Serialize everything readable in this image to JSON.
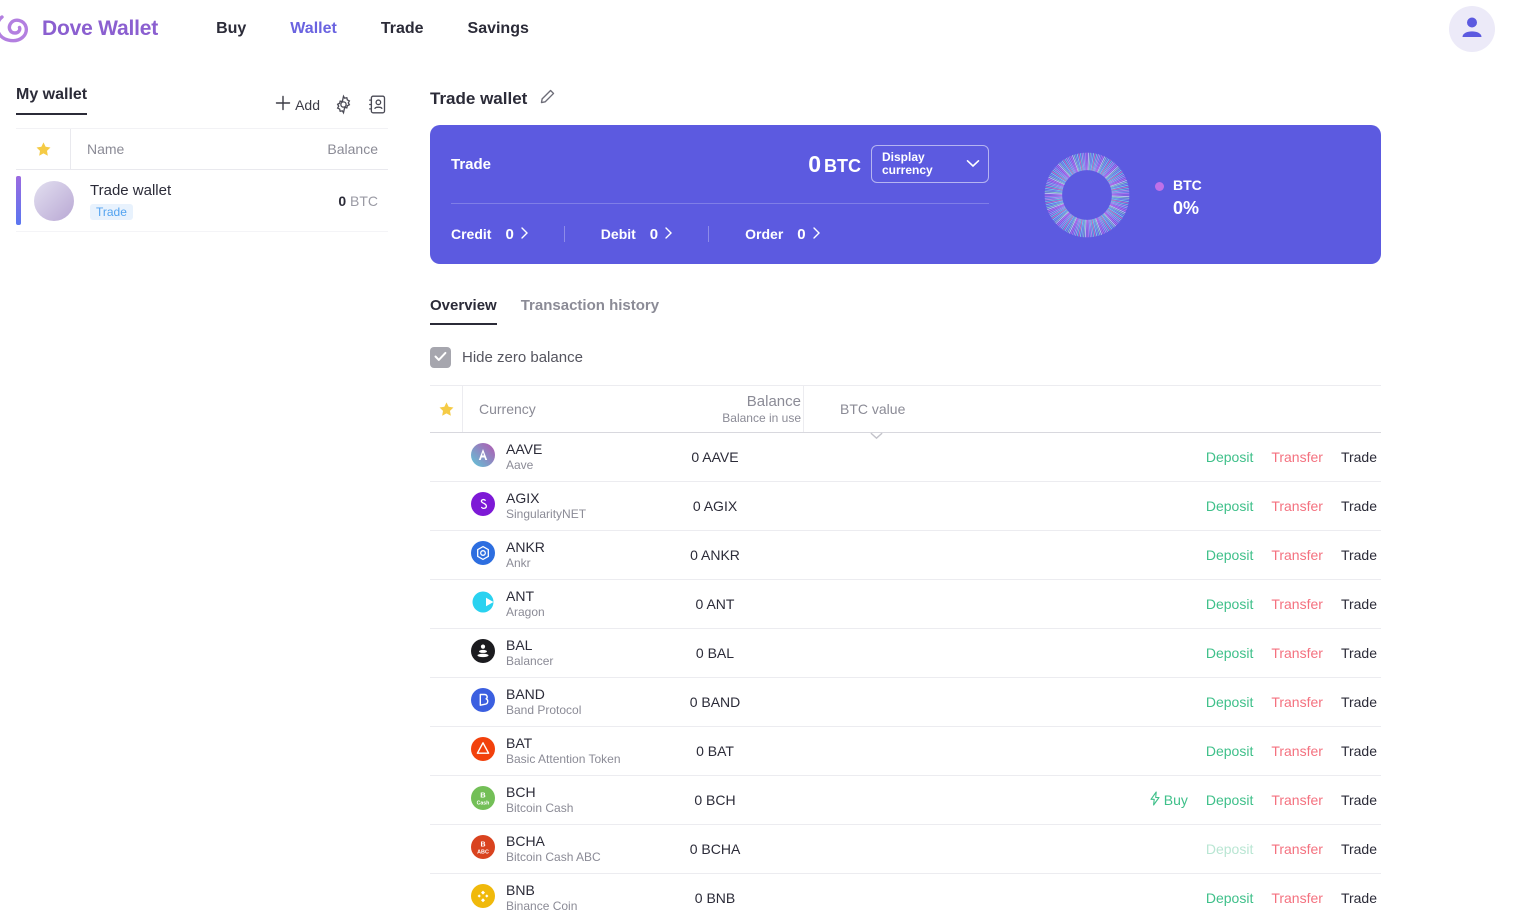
{
  "header": {
    "brand": "Dove Wallet",
    "logo_icon": "dove-spiral-logo",
    "nav": [
      {
        "label": "Buy",
        "active": false
      },
      {
        "label": "Wallet",
        "active": true
      },
      {
        "label": "Trade",
        "active": false
      },
      {
        "label": "Savings",
        "active": false
      }
    ],
    "avatar_icon": "user-avatar-icon"
  },
  "sidebar": {
    "title": "My wallet",
    "add_label": "Add",
    "add_icon": "plus-icon",
    "settings_icon": "gear-icon",
    "address_book_icon": "address-book-icon",
    "columns": {
      "star": "star-icon",
      "name": "Name",
      "balance": "Balance"
    },
    "wallets": [
      {
        "name": "Trade wallet",
        "tag": "Trade",
        "balance_value": "0",
        "balance_unit": "BTC",
        "selected": true
      }
    ]
  },
  "main": {
    "title": "Trade wallet",
    "edit_icon": "pencil-icon",
    "card": {
      "label": "Trade",
      "amount": "0",
      "unit": "BTC",
      "display_currency_label": "Display currency",
      "chevron_icon": "chevron-down-icon",
      "stats": [
        {
          "label": "Credit",
          "value": "0",
          "chevron": "chevron-right-icon"
        },
        {
          "label": "Debit",
          "value": "0",
          "chevron": "chevron-right-icon"
        },
        {
          "label": "Order",
          "value": "0",
          "chevron": "chevron-right-icon"
        }
      ],
      "legend": {
        "symbol": "BTC",
        "percent": "0%",
        "dot_color": "#c070e8"
      },
      "bg_color": "#5c5ae0"
    },
    "tabs": [
      {
        "label": "Overview",
        "active": true
      },
      {
        "label": "Transaction history",
        "active": false
      }
    ],
    "hide_zero": {
      "label": "Hide zero balance",
      "checked": true,
      "check_icon": "checkmark-icon"
    },
    "table": {
      "columns": {
        "star": "star-icon",
        "currency": "Currency",
        "balance": "Balance",
        "balance_in_use": "Balance in use",
        "btc_value": "BTC value",
        "sort_icon": "chevron-down-icon"
      },
      "rows": [
        {
          "symbol": "AAVE",
          "name": "Aave",
          "balance": "0 AAVE",
          "btc_value": "",
          "icon": {
            "kind": "aave",
            "bg": "#8e6fc4",
            "fg": "#ffffff"
          },
          "actions": [
            {
              "label": "Deposit",
              "type": "deposit",
              "disabled": false
            },
            {
              "label": "Transfer",
              "type": "transfer"
            },
            {
              "label": "Trade",
              "type": "trade"
            }
          ]
        },
        {
          "symbol": "AGIX",
          "name": "SingularityNET",
          "balance": "0 AGIX",
          "btc_value": "",
          "icon": {
            "kind": "agix",
            "bg": "#7d19d6",
            "fg": "#ffffff"
          },
          "actions": [
            {
              "label": "Deposit",
              "type": "deposit",
              "disabled": false
            },
            {
              "label": "Transfer",
              "type": "transfer"
            },
            {
              "label": "Trade",
              "type": "trade"
            }
          ]
        },
        {
          "symbol": "ANKR",
          "name": "Ankr",
          "balance": "0 ANKR",
          "btc_value": "",
          "icon": {
            "kind": "ankr",
            "bg": "#2d6ee0",
            "fg": "#ffffff"
          },
          "actions": [
            {
              "label": "Deposit",
              "type": "deposit",
              "disabled": false
            },
            {
              "label": "Transfer",
              "type": "transfer"
            },
            {
              "label": "Trade",
              "type": "trade"
            }
          ]
        },
        {
          "symbol": "ANT",
          "name": "Aragon",
          "balance": "0 ANT",
          "btc_value": "",
          "icon": {
            "kind": "ant",
            "bg": "#2ad2f0",
            "fg": "#ffffff"
          },
          "actions": [
            {
              "label": "Deposit",
              "type": "deposit",
              "disabled": false
            },
            {
              "label": "Transfer",
              "type": "transfer"
            },
            {
              "label": "Trade",
              "type": "trade"
            }
          ]
        },
        {
          "symbol": "BAL",
          "name": "Balancer",
          "balance": "0 BAL",
          "btc_value": "",
          "icon": {
            "kind": "bal",
            "bg": "#1b1b1f",
            "fg": "#ffffff"
          },
          "actions": [
            {
              "label": "Deposit",
              "type": "deposit",
              "disabled": false
            },
            {
              "label": "Transfer",
              "type": "transfer"
            },
            {
              "label": "Trade",
              "type": "trade"
            }
          ]
        },
        {
          "symbol": "BAND",
          "name": "Band Protocol",
          "balance": "0 BAND",
          "btc_value": "",
          "icon": {
            "kind": "band",
            "bg": "#3b5fe0",
            "fg": "#ffffff"
          },
          "actions": [
            {
              "label": "Deposit",
              "type": "deposit",
              "disabled": false
            },
            {
              "label": "Transfer",
              "type": "transfer"
            },
            {
              "label": "Trade",
              "type": "trade"
            }
          ]
        },
        {
          "symbol": "BAT",
          "name": "Basic Attention Token",
          "balance": "0 BAT",
          "btc_value": "",
          "icon": {
            "kind": "bat",
            "bg": "#f2410c",
            "fg": "#ffffff"
          },
          "actions": [
            {
              "label": "Deposit",
              "type": "deposit",
              "disabled": false
            },
            {
              "label": "Transfer",
              "type": "transfer"
            },
            {
              "label": "Trade",
              "type": "trade"
            }
          ]
        },
        {
          "symbol": "BCH",
          "name": "Bitcoin Cash",
          "balance": "0 BCH",
          "btc_value": "",
          "icon": {
            "kind": "bch",
            "bg": "#73bf57",
            "fg": "#ffffff"
          },
          "actions": [
            {
              "label": "Buy",
              "type": "buy",
              "icon": "lightning-icon"
            },
            {
              "label": "Deposit",
              "type": "deposit",
              "disabled": false
            },
            {
              "label": "Transfer",
              "type": "transfer"
            },
            {
              "label": "Trade",
              "type": "trade"
            }
          ]
        },
        {
          "symbol": "BCHA",
          "name": "Bitcoin Cash ABC",
          "balance": "0 BCHA",
          "btc_value": "",
          "icon": {
            "kind": "bcha",
            "bg": "#d9431f",
            "fg": "#ffffff"
          },
          "actions": [
            {
              "label": "Deposit",
              "type": "deposit",
              "disabled": true
            },
            {
              "label": "Transfer",
              "type": "transfer"
            },
            {
              "label": "Trade",
              "type": "trade"
            }
          ]
        },
        {
          "symbol": "BNB",
          "name": "Binance Coin",
          "balance": "0 BNB",
          "btc_value": "",
          "icon": {
            "kind": "bnb",
            "bg": "#f0b90b",
            "fg": "#ffffff"
          },
          "actions": [
            {
              "label": "Deposit",
              "type": "deposit",
              "disabled": false
            },
            {
              "label": "Transfer",
              "type": "transfer"
            },
            {
              "label": "Trade",
              "type": "trade"
            }
          ]
        }
      ]
    }
  },
  "colors": {
    "brand_purple": "#8b5fd0",
    "nav_active": "#6a63e0",
    "card_bg": "#5c5ae0",
    "deposit_green": "#3fc08a",
    "transfer_red": "#f4717f",
    "tag_blue": "#53a3f0"
  }
}
